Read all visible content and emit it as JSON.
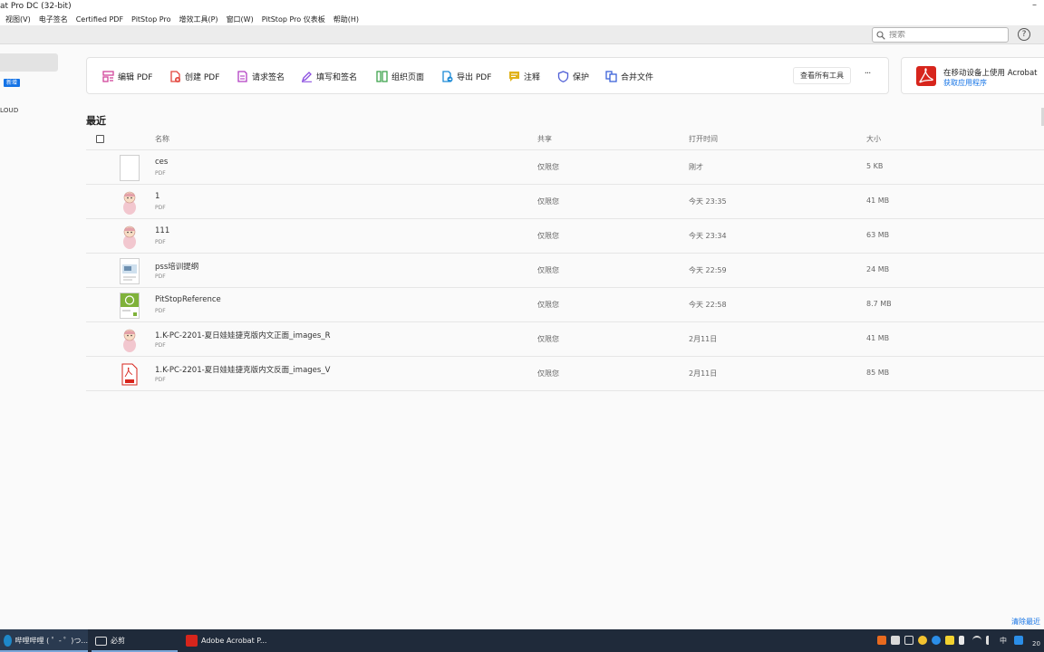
{
  "window": {
    "title": "at Pro DC (32-bit)",
    "minimize_glyph": "–"
  },
  "menubar": {
    "items": [
      "视图(V)",
      "电子签名",
      "Certified PDF",
      "PitStop Pro",
      "增效工具(P)",
      "窗口(W)",
      "PitStop Pro 仪表板",
      "帮助(H)"
    ]
  },
  "search": {
    "placeholder": "搜索",
    "icon": "search-icon"
  },
  "help": {
    "glyph": "?"
  },
  "sidebar": {
    "new_badge": "新增",
    "cloud_label": "LOUD"
  },
  "tools": {
    "items": [
      {
        "label": "编辑 PDF",
        "icon": "edit-pdf-icon",
        "color": "#d1459a"
      },
      {
        "label": "创建 PDF",
        "icon": "create-pdf-icon",
        "color": "#e2433b"
      },
      {
        "label": "请求签名",
        "icon": "request-signature-icon",
        "color": "#b23fc2"
      },
      {
        "label": "填写和签名",
        "icon": "fill-sign-icon",
        "color": "#8a4de0"
      },
      {
        "label": "组织页面",
        "icon": "organize-pages-icon",
        "color": "#3fa34d"
      },
      {
        "label": "导出 PDF",
        "icon": "export-pdf-icon",
        "color": "#1c8ad6"
      },
      {
        "label": "注释",
        "icon": "comment-icon",
        "color": "#e0b21a"
      },
      {
        "label": "保护",
        "icon": "protect-icon",
        "color": "#4f5fd6"
      },
      {
        "label": "合并文件",
        "icon": "combine-files-icon",
        "color": "#3b62d9"
      }
    ],
    "view_all": "查看所有工具",
    "more": "···"
  },
  "promo": {
    "title": "在移动设备上使用 Acrobat",
    "link": "获取应用程序",
    "brand_color": "#d7251c"
  },
  "recent": {
    "title": "最近",
    "columns": {
      "name": "名称",
      "share": "共享",
      "opened": "打开时间",
      "size": "大小"
    },
    "files": [
      {
        "name": "ces",
        "type": "PDF",
        "share": "仅限您",
        "opened": "刚才",
        "size": "5 KB",
        "thumb": "blank-page"
      },
      {
        "name": "1",
        "type": "PDF",
        "share": "仅限您",
        "opened": "今天 23:35",
        "size": "41 MB",
        "thumb": "doll"
      },
      {
        "name": "111",
        "type": "PDF",
        "share": "仅限您",
        "opened": "今天 23:34",
        "size": "63 MB",
        "thumb": "doll"
      },
      {
        "name": "pss培训提纲",
        "type": "PDF",
        "share": "仅限您",
        "opened": "今天 22:59",
        "size": "24 MB",
        "thumb": "slide"
      },
      {
        "name": "PitStopReference",
        "type": "PDF",
        "share": "仅限您",
        "opened": "今天 22:58",
        "size": "8.7 MB",
        "thumb": "green-cover"
      },
      {
        "name": "1.K-PC-2201-夏日娃娃捷克版内文正面_images_R",
        "type": "PDF",
        "share": "仅限您",
        "opened": "2月11日",
        "size": "41 MB",
        "thumb": "doll"
      },
      {
        "name": "1.K-PC-2201-夏日娃娃捷克版内文反面_images_V",
        "type": "PDF",
        "share": "仅限您",
        "opened": "2月11日",
        "size": "85 MB",
        "thumb": "pdf-icon"
      }
    ],
    "clear_label": "清除最近"
  },
  "taskbar": {
    "apps": [
      {
        "label": "哔哩哔哩 ( ゜- ゜)つ...",
        "icon": "bilibili-icon"
      },
      {
        "label": "必剪",
        "icon": "bijian-icon"
      },
      {
        "label": "Adobe Acrobat P...",
        "icon": "acrobat-icon"
      }
    ],
    "ime": "中",
    "clock_fragment": "20"
  }
}
